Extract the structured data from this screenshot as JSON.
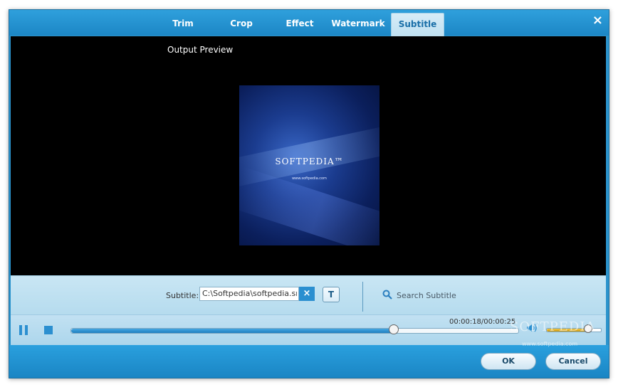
{
  "tabs": [
    {
      "label": "Trim"
    },
    {
      "label": "Crop"
    },
    {
      "label": "Effect"
    },
    {
      "label": "Watermark"
    },
    {
      "label": "Subtitle",
      "active": true
    }
  ],
  "close_icon": "×",
  "preview": {
    "label": "Output Preview",
    "poster_brand": "SOFTPEDIA™",
    "poster_url": "www.softpedia.com"
  },
  "subtitle": {
    "label": "Subtitle:",
    "value": "C:\\Softpedia\\softpedia.srt",
    "clear_icon": "×",
    "style_button": "T",
    "search_label": "Search Subtitle",
    "search_icon": "magnifier-icon"
  },
  "playback": {
    "time": "00:00:18/00:00:25",
    "progress": 0.72,
    "volume": 0.75
  },
  "watermark": {
    "text": "SOFTPEDIA",
    "url": "www.softpedia.com"
  },
  "footer": {
    "ok_label": "OK",
    "cancel_label": "Cancel"
  },
  "colors": {
    "accent": "#2b8fd0",
    "titlebar": "#1c86c5",
    "volume_fill": "#e0b42a"
  }
}
